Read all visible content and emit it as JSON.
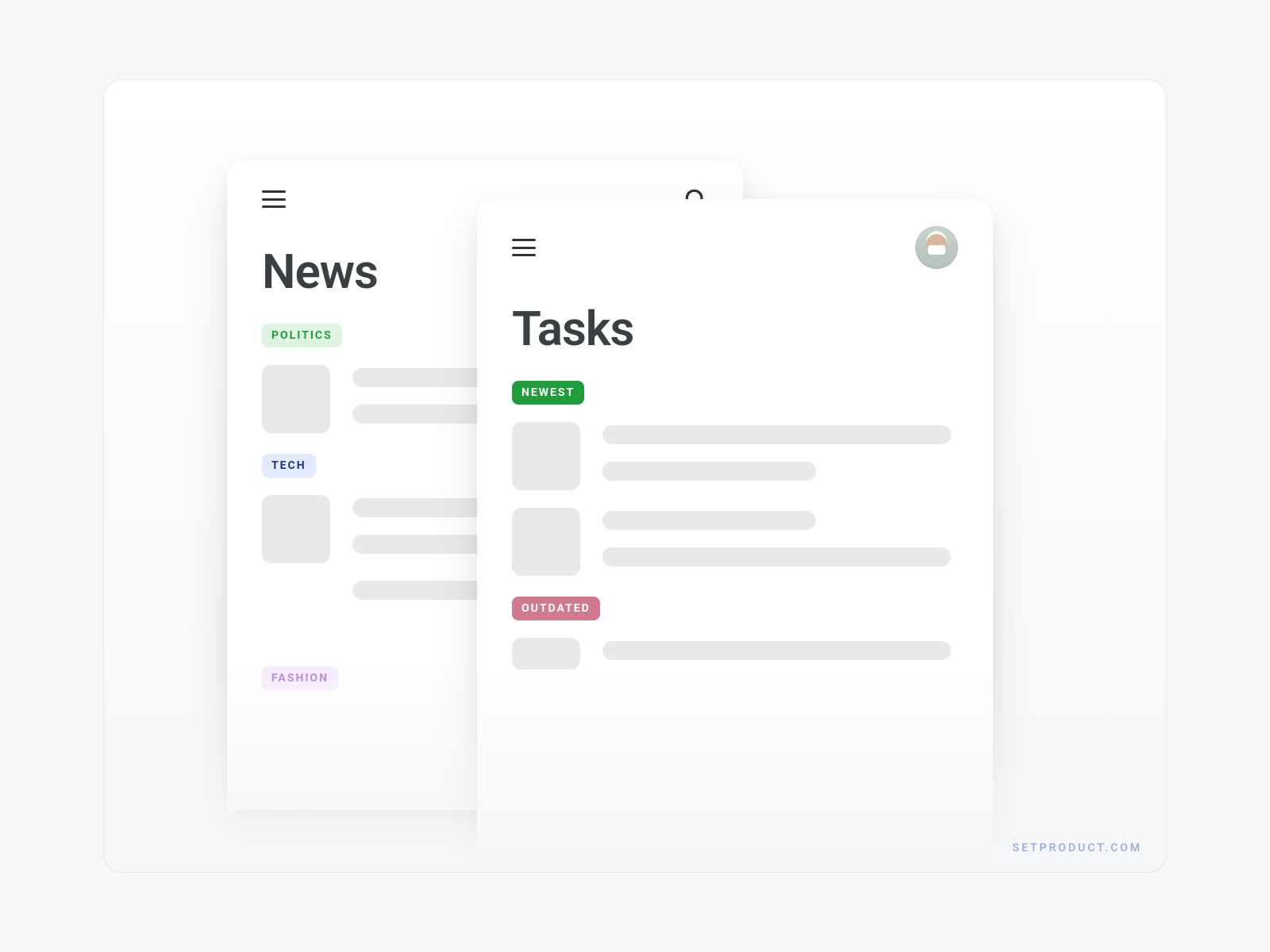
{
  "credit": "SETPRODUCT.COM",
  "news_card": {
    "title": "News",
    "sections": [
      {
        "badge": "POLITICS",
        "bg": "#dff5e1",
        "fg": "#1f9d3a"
      },
      {
        "badge": "TECH",
        "bg": "#e3ecff",
        "fg": "#1a2f8a"
      },
      {
        "badge": "FASHION",
        "bg": "#f6e9ff",
        "fg": "#a86fd0"
      }
    ]
  },
  "tasks_card": {
    "title": "Tasks",
    "sections": [
      {
        "badge": "NEWEST",
        "bg": "#1f9d3a",
        "fg": "#ffffff"
      },
      {
        "badge": "OUTDATED",
        "bg": "#d17a8e",
        "fg": "#ffffff"
      }
    ]
  }
}
